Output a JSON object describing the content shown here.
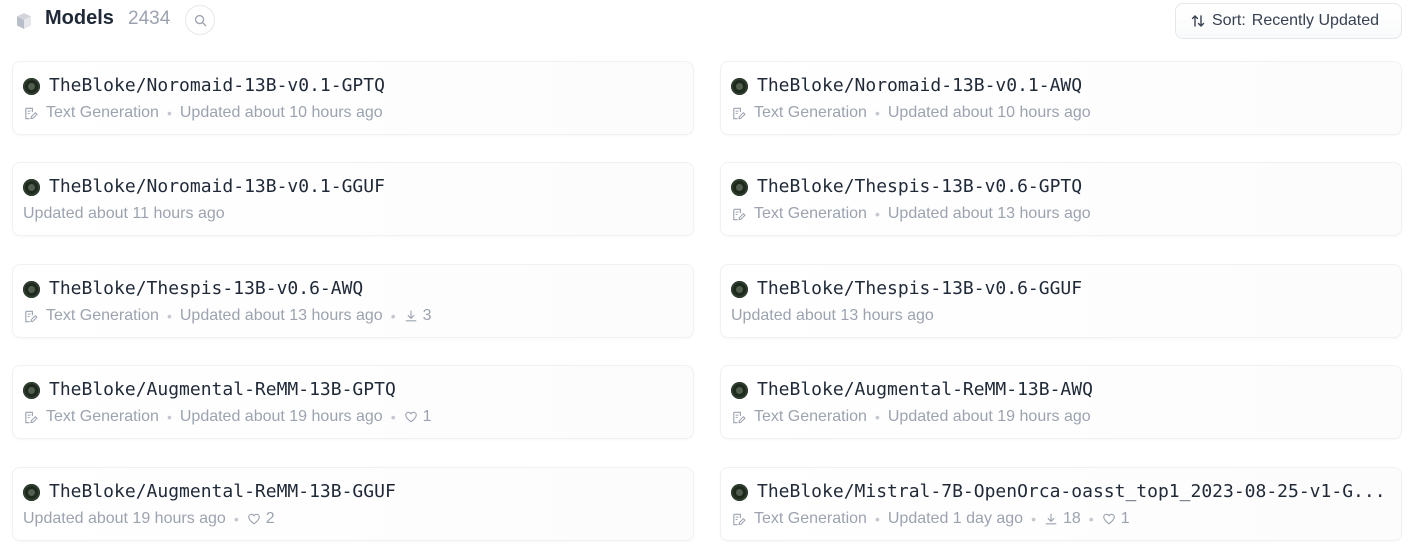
{
  "header": {
    "title": "Models",
    "count": "2434",
    "sort_label": "Sort:",
    "sort_value": "Recently Updated"
  },
  "models": [
    {
      "name": "TheBloke/Noromaid-13B-v0.1-GPTQ",
      "task": "Text Generation",
      "updated": "Updated about 10 hours ago"
    },
    {
      "name": "TheBloke/Noromaid-13B-v0.1-AWQ",
      "task": "Text Generation",
      "updated": "Updated about 10 hours ago"
    },
    {
      "name": "TheBloke/Noromaid-13B-v0.1-GGUF",
      "updated": "Updated about 11 hours ago"
    },
    {
      "name": "TheBloke/Thespis-13B-v0.6-GPTQ",
      "task": "Text Generation",
      "updated": "Updated about 13 hours ago"
    },
    {
      "name": "TheBloke/Thespis-13B-v0.6-AWQ",
      "task": "Text Generation",
      "updated": "Updated about 13 hours ago",
      "downloads": "3"
    },
    {
      "name": "TheBloke/Thespis-13B-v0.6-GGUF",
      "updated": "Updated about 13 hours ago"
    },
    {
      "name": "TheBloke/Augmental-ReMM-13B-GPTQ",
      "task": "Text Generation",
      "updated": "Updated about 19 hours ago",
      "likes": "1"
    },
    {
      "name": "TheBloke/Augmental-ReMM-13B-AWQ",
      "task": "Text Generation",
      "updated": "Updated about 19 hours ago"
    },
    {
      "name": "TheBloke/Augmental-ReMM-13B-GGUF",
      "updated": "Updated about 19 hours ago",
      "likes": "2"
    },
    {
      "name": "TheBloke/Mistral-7B-OpenOrca-oasst_top1_2023-08-25-v1-G...",
      "task": "Text Generation",
      "updated": "Updated 1 day ago",
      "downloads": "18",
      "likes": "1"
    }
  ]
}
